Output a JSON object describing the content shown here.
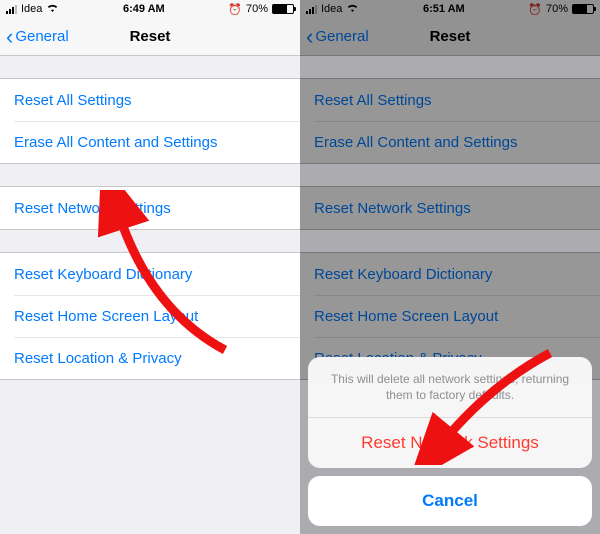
{
  "left": {
    "status": {
      "carrier": "Idea",
      "time": "6:49 AM",
      "battery_pct": "70%",
      "alarm": "⏰"
    },
    "nav": {
      "back": "General",
      "title": "Reset"
    },
    "group1": [
      {
        "label": "Reset All Settings"
      },
      {
        "label": "Erase All Content and Settings"
      }
    ],
    "group2": [
      {
        "label": "Reset Network Settings"
      }
    ],
    "group3": [
      {
        "label": "Reset Keyboard Dictionary"
      },
      {
        "label": "Reset Home Screen Layout"
      },
      {
        "label": "Reset Location & Privacy"
      }
    ]
  },
  "right": {
    "status": {
      "carrier": "Idea",
      "time": "6:51 AM",
      "battery_pct": "70%",
      "alarm": "⏰"
    },
    "nav": {
      "back": "General",
      "title": "Reset"
    },
    "group1": [
      {
        "label": "Reset All Settings"
      },
      {
        "label": "Erase All Content and Settings"
      }
    ],
    "group2": [
      {
        "label": "Reset Network Settings"
      }
    ],
    "group3": [
      {
        "label": "Reset Keyboard Dictionary"
      },
      {
        "label": "Reset Home Screen Layout"
      },
      {
        "label": "Reset Location & Privacy"
      }
    ],
    "sheet": {
      "message": "This will delete all network settings, returning them to factory defaults.",
      "action": "Reset Network Settings",
      "cancel": "Cancel"
    }
  },
  "colors": {
    "ios_blue": "#007aff",
    "ios_red": "#ff3b30",
    "bg": "#efeff4"
  }
}
